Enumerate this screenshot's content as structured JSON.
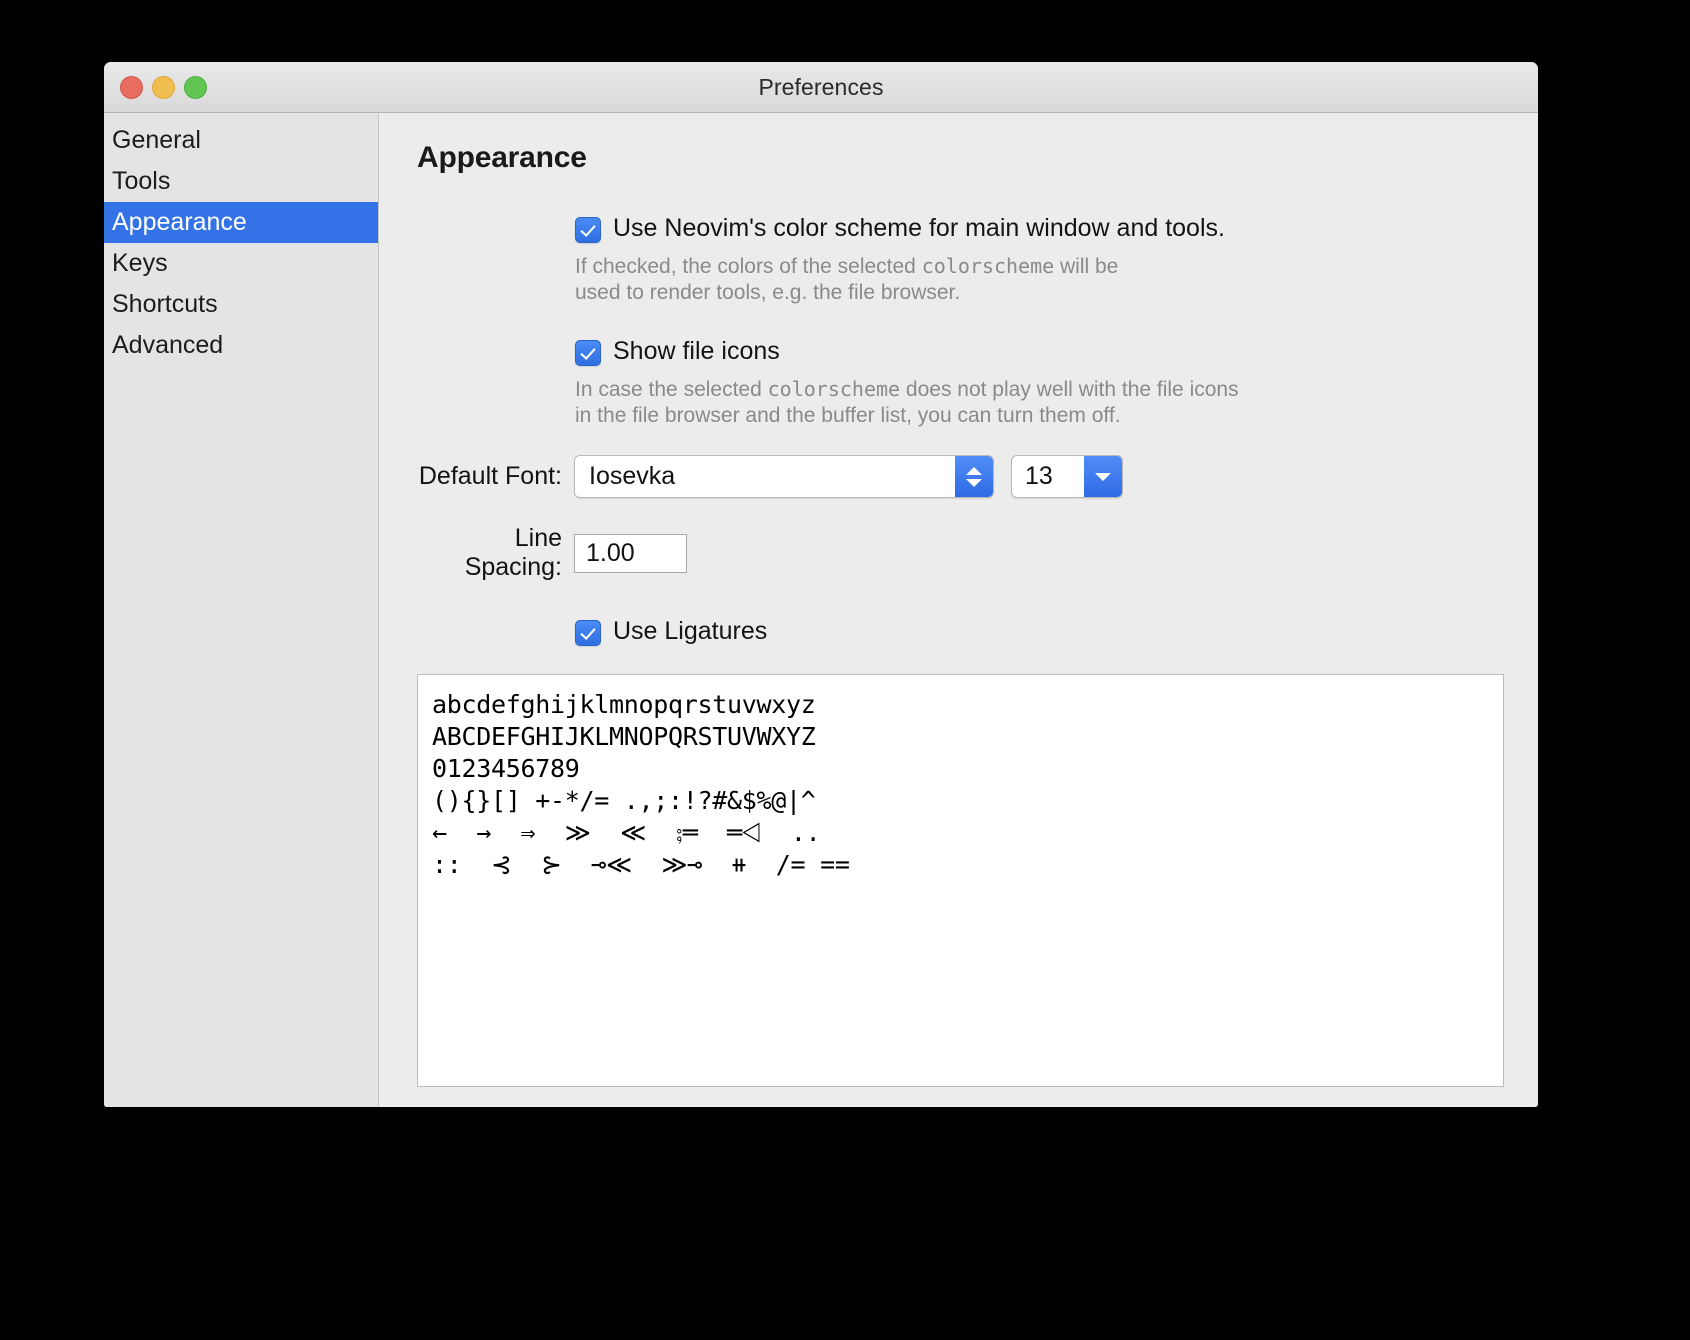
{
  "window": {
    "title": "Preferences",
    "traffic_lights": [
      {
        "name": "close",
        "color": "#e86d61"
      },
      {
        "name": "minimize",
        "color": "#f0be4f"
      },
      {
        "name": "maximize",
        "color": "#61c554"
      }
    ]
  },
  "sidebar": {
    "items": [
      {
        "label": "General",
        "selected": false
      },
      {
        "label": "Tools",
        "selected": false
      },
      {
        "label": "Appearance",
        "selected": true
      },
      {
        "label": "Keys",
        "selected": false
      },
      {
        "label": "Shortcuts",
        "selected": false
      },
      {
        "label": "Advanced",
        "selected": false
      }
    ],
    "selected_color": "#3472e8"
  },
  "main": {
    "heading": "Appearance",
    "color_scheme": {
      "checkbox_label": "Use Neovim's color scheme for main window and tools.",
      "checked": true,
      "help_part1": "If checked, the colors of the selected ",
      "help_mono": "colorscheme",
      "help_part2": " will be",
      "help_line2": "used to render tools, e.g. the file browser."
    },
    "file_icons": {
      "checkbox_label": "Show file icons",
      "checked": true,
      "help_part1": "In case the selected ",
      "help_mono": "colorscheme",
      "help_part2": " does not play well with the file icons",
      "help_line2": "in the file browser and the buffer list, you can turn them off."
    },
    "default_font": {
      "label": "Default Font:",
      "value": "Iosevka",
      "size_value": "13"
    },
    "line_spacing": {
      "label": "Line Spacing:",
      "value": "1.00"
    },
    "ligatures": {
      "checkbox_label": "Use Ligatures",
      "checked": true
    },
    "preview": {
      "lines": [
        "abcdefghijklmnopqrstuvwxyz",
        "ABCDEFGHIJKLMNOPQRSTUVWXYZ",
        "0123456789",
        "(){}[] +-*/= .,;:!?#&$%@|^",
        "←  →  ⇒  ≫  ≪  ⨟═  ═⨞  ..",
        "::  ⊰  ⊱  ⊸≪  ≫⊸  ⧺  /= =="
      ]
    }
  }
}
